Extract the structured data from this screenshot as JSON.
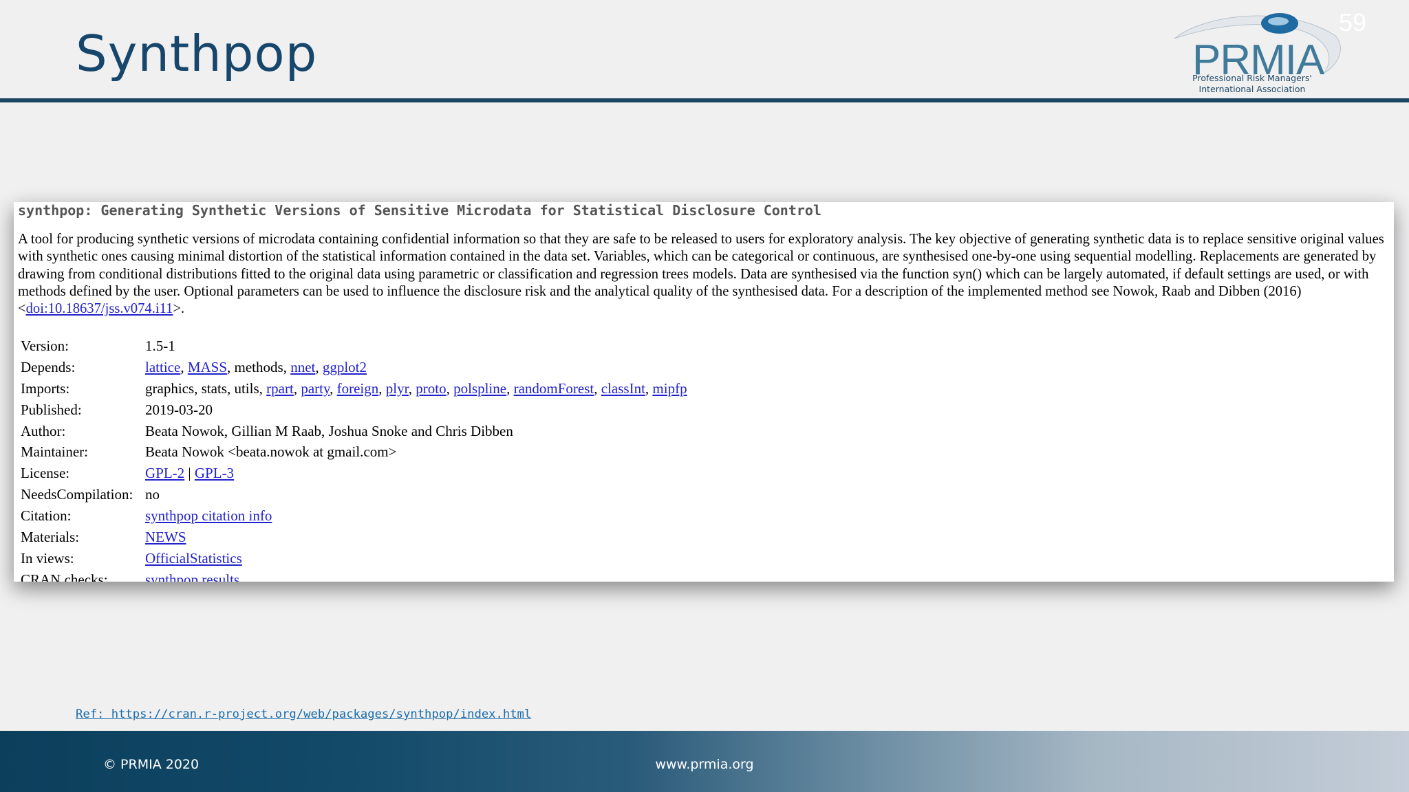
{
  "slide": {
    "title": "Synthpop",
    "page_number": "59",
    "logo": {
      "name": "PRMIA",
      "tagline_line1": "Professional Risk Managers'",
      "tagline_line2": "International Association"
    },
    "reference": "Ref: https://cran.r-project.org/web/packages/synthpop/index.html",
    "footer": {
      "copyright": "© PRMIA 2020",
      "website": "www.prmia.org"
    },
    "colors": {
      "title": "#16466b",
      "rule": "#1b4563",
      "link": "#2222cc",
      "footer_start": "#0b3f5c",
      "footer_end": "#c4cdd8"
    }
  },
  "cran_page": {
    "title": "synthpop: Generating Synthetic Versions of Sensitive Microdata for Statistical Disclosure Control",
    "description": {
      "text": "A tool for producing synthetic versions of microdata containing confidential information so that they are safe to be released to users for exploratory analysis. The key objective of generating synthetic data is to replace sensitive original values with synthetic ones causing minimal distortion of the statistical information contained in the data set. Variables, which can be categorical or continuous, are synthesised one-by-one using sequential modelling. Replacements are generated by drawing from conditional distributions fitted to the original data using parametric or classification and regression trees models. Data are synthesised via the function syn() which can be largely automated, if default settings are used, or with methods defined by the user. Optional parameters can be used to influence the disclosure risk and the analytical quality of the synthesised data. For a description of the implemented method see Nowok, Raab and Dibben (2016) <",
      "doi_link": "doi:10.18637/jss.v074.i11",
      "end": ">."
    },
    "fields": {
      "version": {
        "label": "Version:",
        "value": "1.5-1"
      },
      "depends": {
        "label": "Depends:",
        "lattice": "lattice",
        "mass": "MASS",
        "methods": "methods",
        "nnet": "nnet",
        "ggplot2": "ggplot2"
      },
      "imports": {
        "label": "Imports:",
        "plain": "graphics, stats, utils",
        "rpart": "rpart",
        "party": "party",
        "foreign": "foreign",
        "plyr": "plyr",
        "proto": "proto",
        "polspline": "polspline",
        "randomForest": "randomForest",
        "classInt": "classInt",
        "mipfp": "mipfp"
      },
      "published": {
        "label": "Published:",
        "value": "2019-03-20"
      },
      "author": {
        "label": "Author:",
        "value": "Beata Nowok, Gillian M Raab, Joshua Snoke and Chris Dibben"
      },
      "maintainer": {
        "label": "Maintainer:",
        "value": "Beata Nowok <beata.nowok at gmail.com>"
      },
      "license": {
        "label": "License:",
        "gpl2": "GPL-2",
        "separator": "|",
        "gpl3": "GPL-3"
      },
      "needs_compilation": {
        "label": "NeedsCompilation:",
        "value": "no"
      },
      "citation": {
        "label": "Citation:",
        "link": "synthpop citation info"
      },
      "materials": {
        "label": "Materials:",
        "link": "NEWS"
      },
      "in_views": {
        "label": "In views:",
        "link": "OfficialStatistics"
      },
      "cran_checks": {
        "label": "CRAN checks:",
        "link": "synthpop results"
      }
    }
  }
}
